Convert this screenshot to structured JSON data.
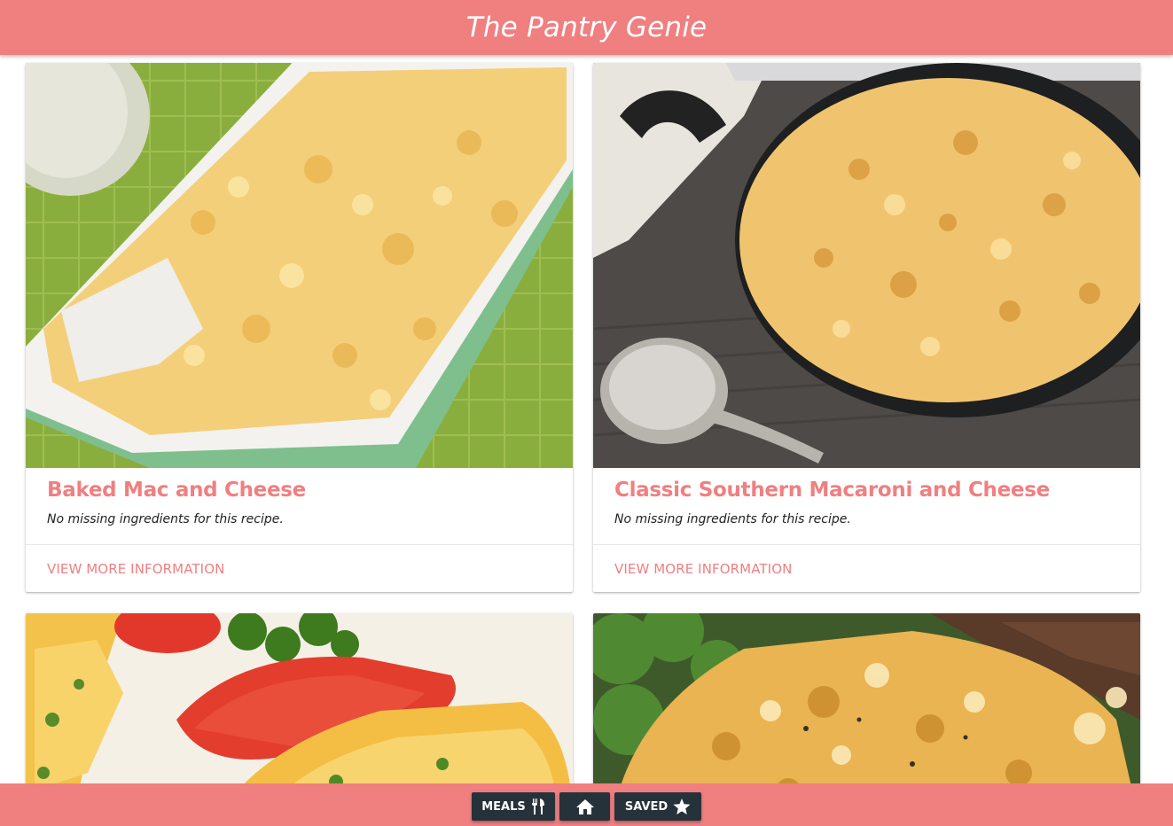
{
  "app": {
    "title": "The Pantry Genie"
  },
  "recipes": [
    {
      "title": "Baked Mac and Cheese",
      "note": "No missing ingredients for this recipe.",
      "action": "VIEW MORE INFORMATION"
    },
    {
      "title": "Classic Southern Macaroni and Cheese",
      "note": "No missing ingredients for this recipe.",
      "action": "VIEW MORE INFORMATION"
    },
    {
      "title": "",
      "note": "",
      "action": ""
    },
    {
      "title": "",
      "note": "",
      "action": ""
    }
  ],
  "nav": {
    "meals_label": "MEALS",
    "meals_icon": "utensils-icon",
    "home_icon": "home-icon",
    "saved_label": "SAVED",
    "saved_icon": "star-icon"
  },
  "colors": {
    "brand": "#f07f80",
    "nav_button": "#26323a"
  }
}
